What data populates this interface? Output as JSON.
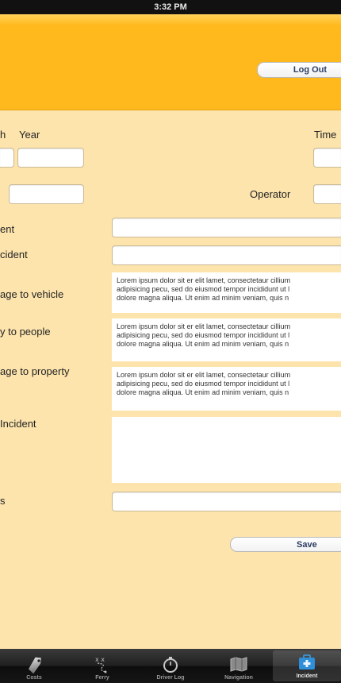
{
  "status_bar": {
    "time": "3:32 PM"
  },
  "header": {
    "logout_label": "Log Out"
  },
  "form": {
    "month_label_partial": "h",
    "year_label": "Year",
    "time_label": "Time",
    "operator_label": "Operator",
    "field1_label": "ent",
    "field2_label": "cident",
    "vehicle_label": "age to vehicle",
    "people_label": "y to people",
    "property_label": "age to property",
    "incident_label": "Incident",
    "last_label": "s",
    "lorem_line1": "Lorem ipsum dolor sit er elit lamet, consectetaur cillium",
    "lorem_line2": "adipisicing pecu, sed do eiusmod tempor incididunt ut l",
    "lorem_line3": "dolore magna aliqua. Ut enim ad minim veniam, quis n",
    "save_label": "Save"
  },
  "tabbar": {
    "tabs": [
      {
        "label": "Costs",
        "icon": "tag-icon",
        "active": false
      },
      {
        "label": "Ferry",
        "icon": "route-icon",
        "active": false
      },
      {
        "label": "Driver Log",
        "icon": "stopwatch-icon",
        "active": false
      },
      {
        "label": "Navigation",
        "icon": "map-icon",
        "active": false
      },
      {
        "label": "Incident",
        "icon": "first-aid-kit-icon",
        "active": true
      }
    ]
  },
  "colors": {
    "background": "#fde4ad",
    "header": "#ffb91c",
    "tabbar": "#1a1a1a",
    "button_text": "#2c3e64"
  }
}
